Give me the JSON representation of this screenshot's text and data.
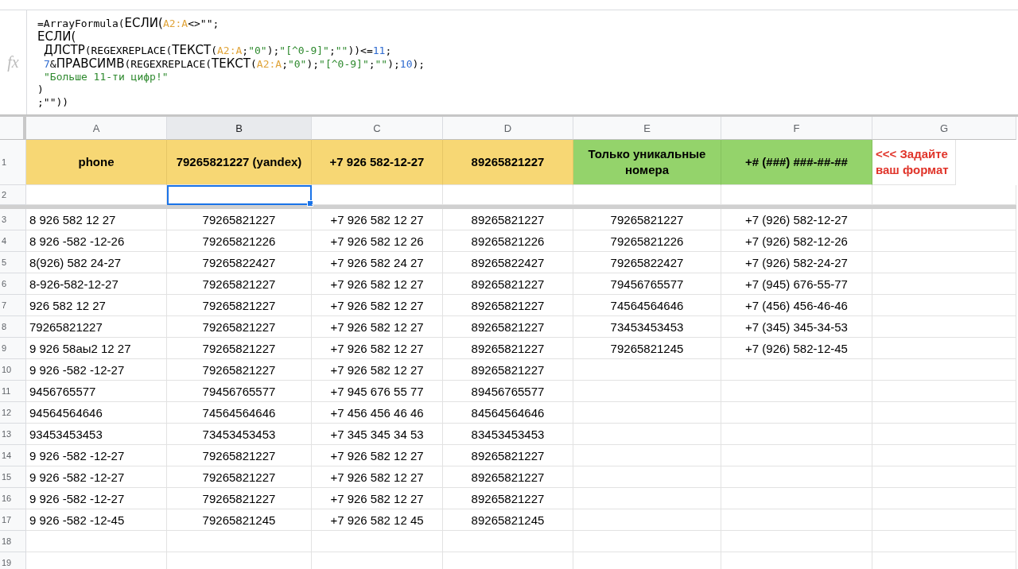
{
  "formula_bar": {
    "icon_label": "fx",
    "lines": [
      [
        {
          "kind": "plain",
          "text": "=ArrayFormula("
        },
        {
          "kind": "func",
          "text": "ЕСЛИ("
        },
        {
          "kind": "ref",
          "text": "A2:A"
        },
        {
          "kind": "plain",
          "text": "<>\"\";"
        }
      ],
      [
        {
          "kind": "func",
          "text": "ЕСЛИ("
        }
      ],
      [
        {
          "kind": "func",
          "text": "ДЛСТР",
          "indent": true
        },
        {
          "kind": "plain",
          "text": "(REGEXREPLACE("
        },
        {
          "kind": "func",
          "text": "ТЕКСТ"
        },
        {
          "kind": "plain",
          "text": "("
        },
        {
          "kind": "ref",
          "text": "A2:A"
        },
        {
          "kind": "plain",
          "text": ";"
        },
        {
          "kind": "string",
          "text": "\"0\""
        },
        {
          "kind": "plain",
          "text": ");"
        },
        {
          "kind": "string",
          "text": "\"[^0-9]\""
        },
        {
          "kind": "plain",
          "text": ";"
        },
        {
          "kind": "string",
          "text": "\"\""
        },
        {
          "kind": "plain",
          "text": "))<="
        },
        {
          "kind": "number",
          "text": "11"
        },
        {
          "kind": "plain",
          "text": ";"
        }
      ],
      [
        {
          "kind": "number",
          "text": "7",
          "indent": true
        },
        {
          "kind": "plain",
          "text": "&"
        },
        {
          "kind": "func",
          "text": "ПРАВСИМВ"
        },
        {
          "kind": "plain",
          "text": "(REGEXREPLACE("
        },
        {
          "kind": "func",
          "text": "ТЕКСТ"
        },
        {
          "kind": "plain",
          "text": "("
        },
        {
          "kind": "ref",
          "text": "A2:A"
        },
        {
          "kind": "plain",
          "text": ";"
        },
        {
          "kind": "string",
          "text": "\"0\""
        },
        {
          "kind": "plain",
          "text": ");"
        },
        {
          "kind": "string",
          "text": "\"[^0-9]\""
        },
        {
          "kind": "plain",
          "text": ";"
        },
        {
          "kind": "string",
          "text": "\"\""
        },
        {
          "kind": "plain",
          "text": ");"
        },
        {
          "kind": "number",
          "text": "10"
        },
        {
          "kind": "plain",
          "text": ");"
        }
      ],
      [
        {
          "kind": "string",
          "text": "\"Больше 11-ти цифр!\"",
          "indent": true
        }
      ],
      [
        {
          "kind": "plain",
          "text": ")"
        }
      ],
      [
        {
          "kind": "plain",
          "text": ";\"\"))"
        }
      ]
    ]
  },
  "columns": [
    {
      "label": "A",
      "selected": false
    },
    {
      "label": "B",
      "selected": true
    },
    {
      "label": "C",
      "selected": false
    },
    {
      "label": "D",
      "selected": false
    },
    {
      "label": "E",
      "selected": false
    },
    {
      "label": "F",
      "selected": false
    },
    {
      "label": "G",
      "selected": false
    }
  ],
  "header_row": {
    "number": "1",
    "cells": [
      {
        "kind": "yellow",
        "text": "phone"
      },
      {
        "kind": "yellow",
        "text": "79265821227 (yandex)"
      },
      {
        "kind": "yellow",
        "text": "+7 926 582-12-27"
      },
      {
        "kind": "yellow",
        "text": "89265821227"
      },
      {
        "kind": "green",
        "text": "Только уникальные номера"
      },
      {
        "kind": "green",
        "text": "+# (###) ###-##-##"
      },
      {
        "kind": "note",
        "text": "<<< Задайте ваш формат"
      }
    ]
  },
  "row_2": {
    "number": "2",
    "cells": [
      {
        "selected": false
      },
      {
        "selected": true
      },
      {
        "selected": false
      },
      {
        "selected": false
      },
      {
        "selected": false
      },
      {
        "selected": false
      },
      {
        "selected": false
      }
    ]
  },
  "rows": [
    {
      "number": "3",
      "cells": [
        "8 926 582 12 27",
        "79265821227",
        "+7 926 582 12 27",
        "89265821227",
        "79265821227",
        "+7 (926) 582-12-27"
      ]
    },
    {
      "number": "4",
      "cells": [
        "8 926 -582 -12-26",
        "79265821226",
        "+7 926 582 12 26",
        "89265821226",
        "79265821226",
        "+7 (926) 582-12-26"
      ]
    },
    {
      "number": "5",
      "cells": [
        "8(926)  582 24-27",
        "79265822427",
        "+7 926 582 24 27",
        "89265822427",
        "79265822427",
        "+7 (926) 582-24-27"
      ]
    },
    {
      "number": "6",
      "cells": [
        "8-926-582-12-27",
        "79265821227",
        "+7 926 582 12 27",
        "89265821227",
        "79456765577",
        "+7 (945) 676-55-77"
      ]
    },
    {
      "number": "7",
      "cells": [
        "926 582 12 27",
        "79265821227",
        "+7 926 582 12 27",
        "89265821227",
        "74564564646",
        "+7 (456) 456-46-46"
      ]
    },
    {
      "number": "8",
      "cells": [
        "79265821227",
        "79265821227",
        "+7 926 582 12 27",
        "89265821227",
        "73453453453",
        "+7 (345) 345-34-53"
      ]
    },
    {
      "number": "9",
      "cells": [
        "9 926 58аы2 12 27",
        "79265821227",
        "+7 926 582 12 27",
        "89265821227",
        "79265821245",
        "+7 (926) 582-12-45"
      ]
    },
    {
      "number": "10",
      "cells": [
        "9 926 -582 -12-27",
        "79265821227",
        "+7 926 582 12 27",
        "89265821227"
      ]
    },
    {
      "number": "11",
      "cells": [
        "9456765577",
        "79456765577",
        "+7 945 676 55 77",
        "89456765577"
      ]
    },
    {
      "number": "12",
      "cells": [
        "94564564646",
        "74564564646",
        "+7 456 456 46 46",
        "84564564646"
      ]
    },
    {
      "number": "13",
      "cells": [
        "93453453453",
        "73453453453",
        "+7 345 345 34 53",
        "83453453453"
      ]
    },
    {
      "number": "14",
      "cells": [
        "9 926 -582 -12-27",
        "79265821227",
        "+7 926 582 12 27",
        "89265821227"
      ]
    },
    {
      "number": "15",
      "cells": [
        "9 926 -582 -12-27",
        "79265821227",
        "+7 926 582 12 27",
        "89265821227"
      ]
    },
    {
      "number": "16",
      "cells": [
        "9 926 -582 -12-27",
        "79265821227",
        "+7 926 582 12 27",
        "89265821227"
      ]
    },
    {
      "number": "17",
      "cells": [
        "9 926 -582 -12-45",
        "79265821245",
        "+7 926 582 12 45",
        "89265821245"
      ]
    },
    {
      "number": "18",
      "cells": []
    },
    {
      "number": "19",
      "cells": []
    }
  ]
}
